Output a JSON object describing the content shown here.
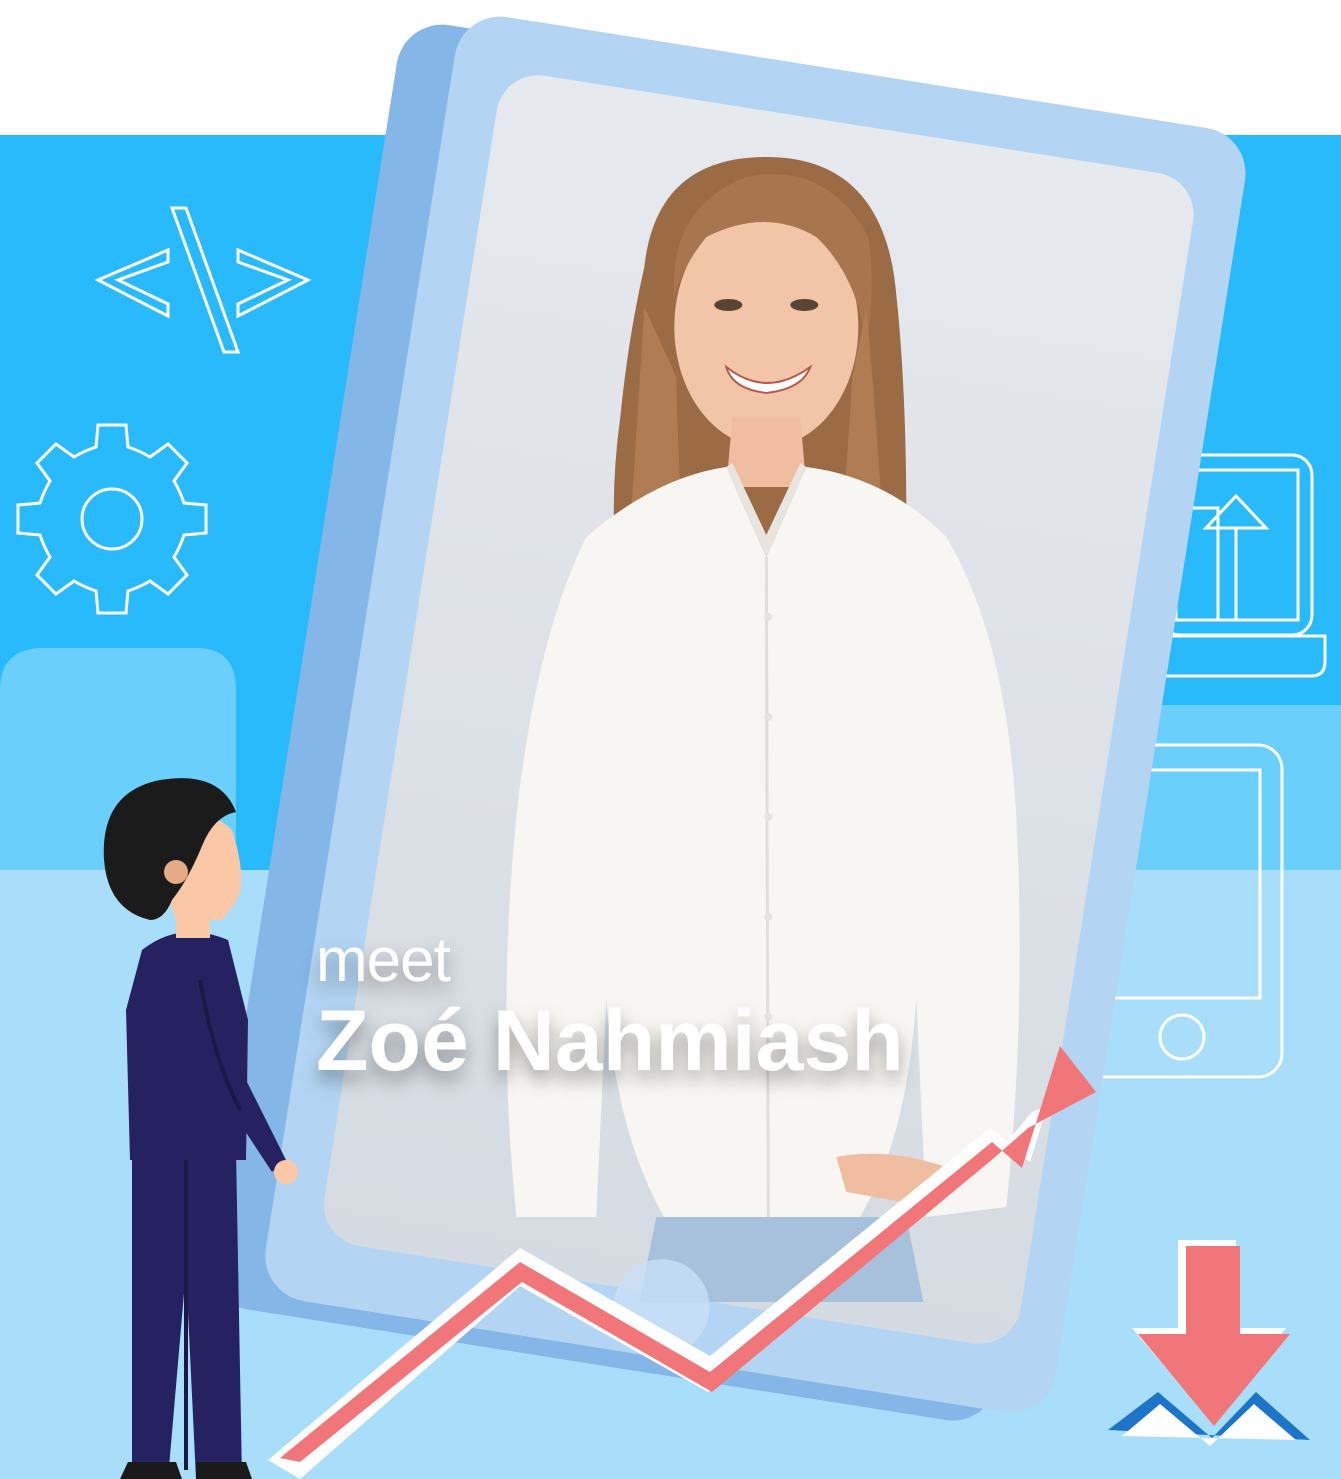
{
  "caption": {
    "prefix": "meet",
    "name": "Zoé Nahmiash"
  },
  "colors": {
    "sky_blue": "#29bafc",
    "light_blue": "#a9defb",
    "mid_blue": "#6bcffb",
    "card_back": "#85b6e8",
    "card_front": "#b3d5f3",
    "photo_bg": "#e2e6ec",
    "trend_red": "#f0767a",
    "suit_navy": "#262262",
    "skin": "#fbc8a7",
    "hair": "#1b1b1b",
    "white": "#ffffff"
  },
  "icons": [
    "code-brackets-icon",
    "gear-icon",
    "laptop-upload-icon",
    "smartphone-icon",
    "download-arrow-icon",
    "trend-up-arrow"
  ]
}
